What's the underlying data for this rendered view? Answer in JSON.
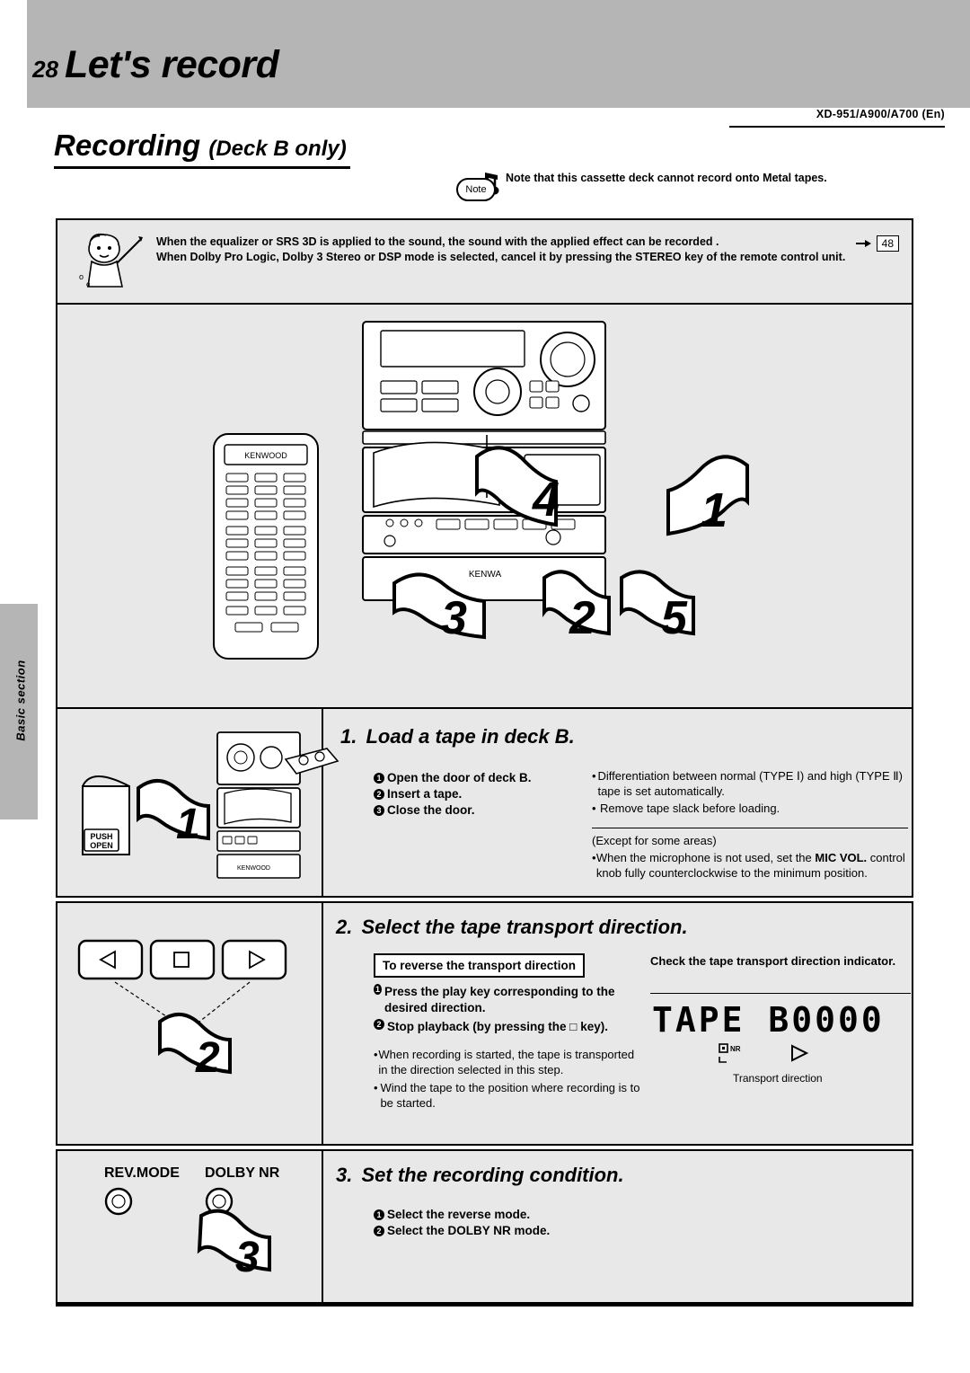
{
  "header": {
    "page_number": "28",
    "title": "Let's record",
    "model_line": "XD-951/A900/A700 (En)"
  },
  "section": {
    "heading_main": "Recording",
    "heading_sub": "(Deck B only)"
  },
  "note": {
    "badge_label": "Note",
    "text": "Note that this cassette deck cannot record onto Metal tapes."
  },
  "caution": {
    "line1": "When the equalizer or SRS 3D is applied to the sound, the sound with the applied effect can be recorded .",
    "line2": "When Dolby Pro Logic, Dolby 3 Stereo or DSP mode is selected, cancel it by pressing the STEREO key of the remote control unit.",
    "page_ref": "48"
  },
  "side_tab": {
    "label": "Basic section"
  },
  "illustration": {
    "remote_brand": "KENWOOD",
    "deck_brand": "KENWA",
    "badges": [
      "4",
      "1",
      "3",
      "2",
      "5"
    ]
  },
  "step1": {
    "title_num": "1.",
    "title": "Load a tape in deck B.",
    "badge": "1",
    "push_open": "PUSH\nOPEN",
    "items": [
      "Open the door of deck B.",
      "Insert a tape.",
      "Close the door."
    ],
    "notes": [
      "Differentiation between normal (TYPE Ⅰ) and high (TYPE Ⅱ) tape is set automatically.",
      "Remove tape slack before loading."
    ],
    "except_line": "(Except for some areas)",
    "mic_note_a": "When the microphone is not used, set the ",
    "mic_note_b": "MIC VOL.",
    "mic_note_c": " control knob fully counterclockwise to the minimum position."
  },
  "step2": {
    "title_num": "2.",
    "title": "Select the tape transport direction.",
    "badge": "2",
    "label_box": "To reverse the transport direction",
    "items": [
      "Press the play key corresponding to the desired direction.",
      "Stop playback (by pressing the □ key)."
    ],
    "notes": [
      "When recording is started, the tape is transported in the direction selected in this step.",
      "Wind the tape to the position where recording is to be started."
    ],
    "check_title": "Check the tape transport direction indicator.",
    "lcd_text": "TAPE  B",
    "lcd_digits": "0000",
    "lcd_nr": "NR",
    "transport_caption": "Transport direction"
  },
  "step3": {
    "title_num": "3.",
    "title": "Set the recording condition.",
    "badge": "3",
    "button1": "REV.MODE",
    "button2": "DOLBY NR",
    "items": [
      "Select the reverse mode.",
      "Select the DOLBY NR mode."
    ]
  }
}
